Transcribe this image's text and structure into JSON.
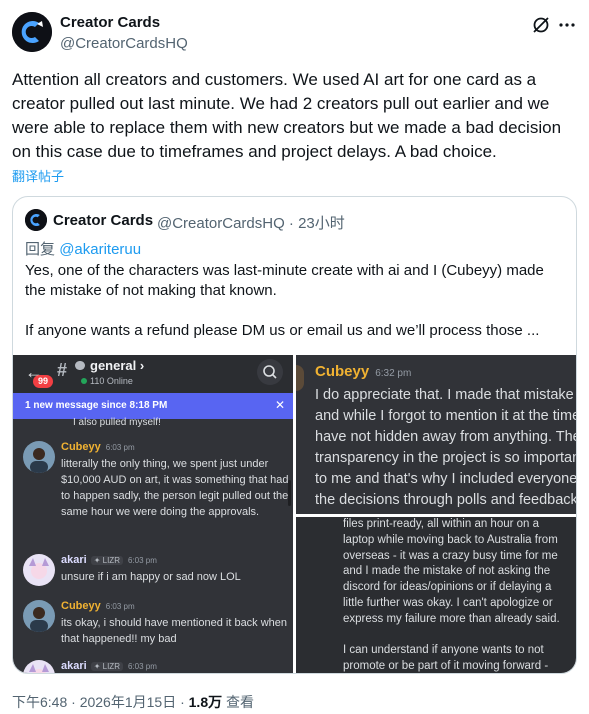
{
  "post": {
    "author_name": "Creator Cards",
    "author_handle": "@CreatorCardsHQ",
    "text": "Attention all creators and customers. We used AI art for one card as a creator pulled out last minute. We had 2 creators pull out earlier and we were able to replace them with new creators but we made a bad decision on this case due to timeframes and project delays. A bad choice.",
    "translate_link": "翻译帖子",
    "header_icons": [
      "grok-icon",
      "more-icon"
    ]
  },
  "quote": {
    "author_name": "Creator Cards",
    "author_handle": "@CreatorCardsHQ · 23小时",
    "reply_prefix": "回复",
    "reply_to": "@akariteruu",
    "text_1": "Yes, one of the characters was last-minute create with ai and I (Cubeyy) made the mistake of not making that known.",
    "text_2": "If anyone wants a refund please DM us or email us and we’ll process those ..."
  },
  "discord_left": {
    "badge": "99",
    "channel": "general ›",
    "online": "110 Online",
    "banner": "1 new message since 8:18 PM",
    "banner_close": "✕",
    "cut_text": "I also pulled myself!",
    "messages": [
      {
        "name": "Cubeyy",
        "time": "6:03 pm",
        "tag": "",
        "body": "litterally the only thing, we spent just under $10,000 AUD on art, it was something that had to happen sadly, the person legit pulled out the same hour we were doing the approvals."
      },
      {
        "name": "akari",
        "time": "6:03 pm",
        "tag": "✦ LIZR",
        "body": "unsure if i am happy or sad now LOL"
      },
      {
        "name": "Cubeyy",
        "time": "6:03 pm",
        "tag": "",
        "body": "its okay, i should have mentioned it back when that happened!! my bad"
      },
      {
        "name": "akari",
        "time": "6:03 pm",
        "tag": "✦ LIZR",
        "body": ""
      }
    ]
  },
  "discord_top_right": {
    "name": "Cubeyy",
    "time": "6:32 pm",
    "lines": [
      "I do appreciate that. I made that mistake",
      "and while I forgot to mention it at the time",
      "have not hidden away from anything. The",
      "transparency in the project is so important",
      "to me and that's why I included everyone",
      "the decisions through polls and feedback"
    ]
  },
  "discord_bottom_right": {
    "text_1": "files print-ready, all within an hour on a laptop while moving back to Australia from overseas - it was a crazy busy time for me and I made the mistake of not asking the discord for ideas/opinions or if delaying a little further was okay. I can't apologize or express my failure more than already said.",
    "text_2": "I can understand if anyone wants to not promote or be part of it moving forward -"
  },
  "footer": {
    "time": "下午6:48 · 2026年1月15日 · ",
    "views": "1.8万",
    "views_label": " 查看"
  },
  "colors": {
    "accent": "#1d9bf0",
    "discord_bg": "#313338",
    "discord_banner": "#5865f2",
    "cubeyy_name": "#f0b232",
    "akari_name": "#dcdcff"
  }
}
